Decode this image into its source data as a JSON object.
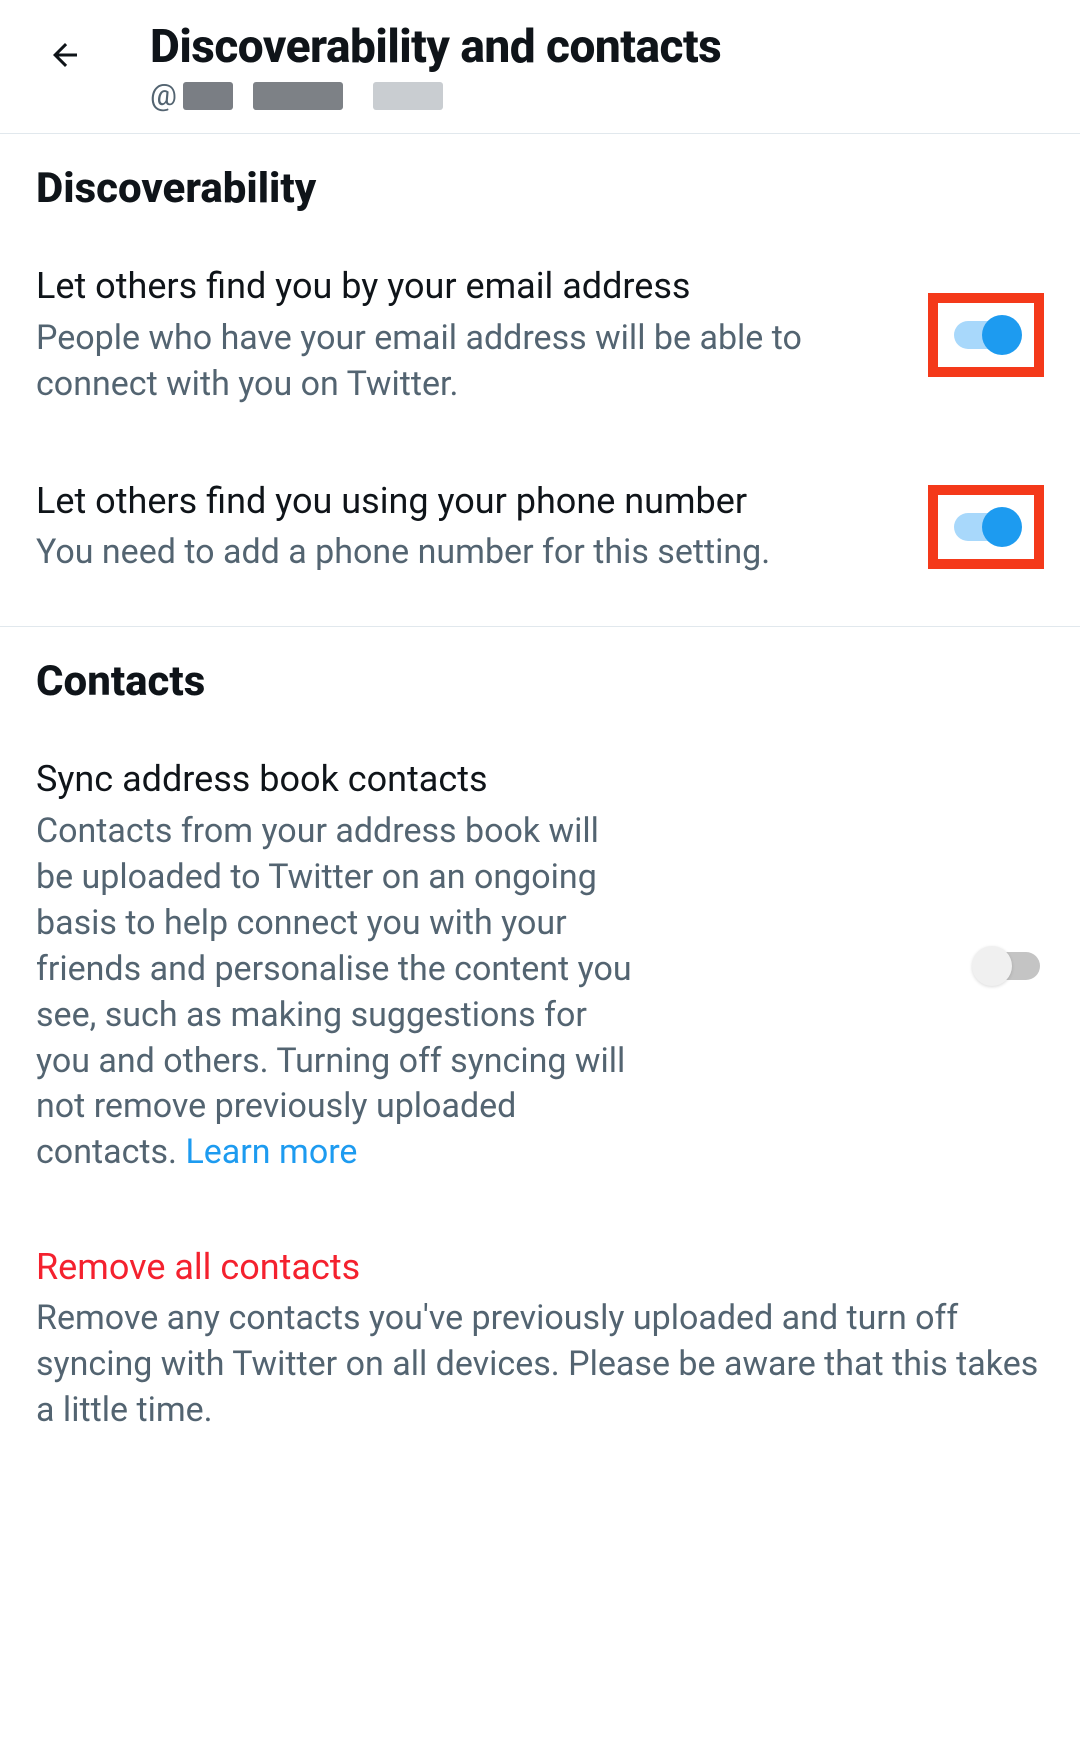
{
  "header": {
    "title": "Discoverability and contacts",
    "username_prefix": "@"
  },
  "sections": {
    "discoverability": {
      "title": "Discoverability",
      "email": {
        "label": "Let others find you by your email address",
        "desc": "People who have your email address will be able to connect with you on Twitter.",
        "on": true
      },
      "phone": {
        "label": "Let others find you using your phone number",
        "desc": "You need to add a phone number for this setting.",
        "on": true
      }
    },
    "contacts": {
      "title": "Contacts",
      "sync": {
        "label": "Sync address book contacts",
        "desc": "Contacts from your address book will be uploaded to Twitter on an ongoing basis to help connect you with your friends and personalise the content you see, such as making suggestions for you and others. Turning off syncing will not remove previously uploaded contacts. ",
        "learn_more": "Learn more",
        "on": false
      },
      "remove": {
        "label": "Remove all contacts",
        "desc": "Remove any contacts you've previously uploaded and turn off syncing with Twitter on all devices. Please be aware that this takes a little time."
      }
    }
  }
}
